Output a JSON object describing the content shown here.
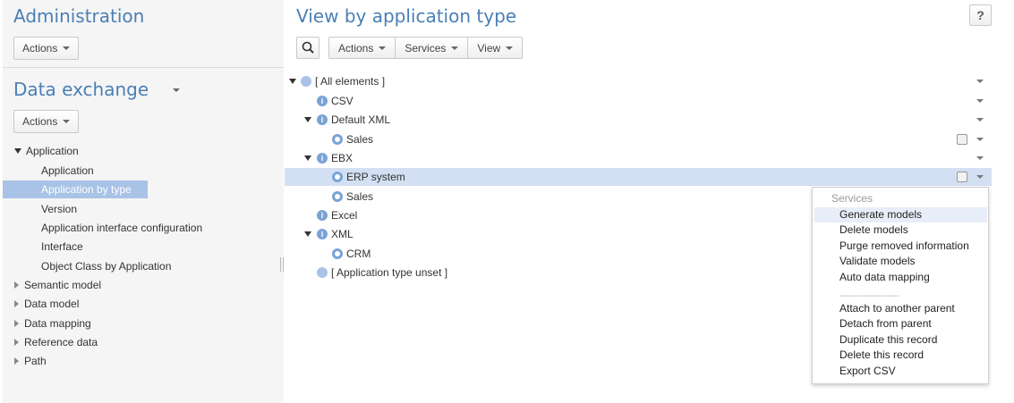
{
  "sidebar": {
    "admin_title": "Administration",
    "admin_actions": "Actions",
    "section_title": "Data exchange",
    "section_actions": "Actions",
    "tree": [
      {
        "label": "Application",
        "level": "top",
        "expanded": true
      },
      {
        "label": "Application",
        "level": "sub"
      },
      {
        "label": "Application by type",
        "level": "sub",
        "selected": true
      },
      {
        "label": "Version",
        "level": "sub"
      },
      {
        "label": "Application interface configuration",
        "level": "sub"
      },
      {
        "label": "Interface",
        "level": "sub"
      },
      {
        "label": "Object Class by Application",
        "level": "sub"
      },
      {
        "label": "Semantic model",
        "level": "top",
        "expanded": false
      },
      {
        "label": "Data model",
        "level": "top",
        "expanded": false
      },
      {
        "label": "Data mapping",
        "level": "top",
        "expanded": false
      },
      {
        "label": "Reference data",
        "level": "top",
        "expanded": false
      },
      {
        "label": "Path",
        "level": "top",
        "expanded": false
      }
    ]
  },
  "main": {
    "title": "View by application type",
    "help_label": "?",
    "toolbar": {
      "actions": "Actions",
      "services": "Services",
      "view": "View"
    },
    "tree": [
      {
        "label": "[ All elements ]",
        "icon": "plain"
      },
      {
        "label": "CSV",
        "icon": "info"
      },
      {
        "label": "Default XML",
        "icon": "info"
      },
      {
        "label": "Sales",
        "icon": "ring"
      },
      {
        "label": "EBX",
        "icon": "info"
      },
      {
        "label": "ERP system",
        "icon": "ring"
      },
      {
        "label": "Sales",
        "icon": "ring"
      },
      {
        "label": "Excel",
        "icon": "info"
      },
      {
        "label": "XML",
        "icon": "info"
      },
      {
        "label": "CRM",
        "icon": "ring"
      },
      {
        "label": "[ Application type unset ]",
        "icon": "plain"
      }
    ]
  },
  "menu": {
    "header": "Services",
    "items": [
      "Generate models",
      "Delete models",
      "Purge removed information",
      "Validate models",
      "Auto data mapping",
      "Attach to another parent",
      "Detach from parent",
      "Duplicate this record",
      "Delete this record",
      "Export CSV"
    ],
    "divider": "--------------------"
  },
  "colors": {
    "accent": "#4a7fb5",
    "selection": "#a9c3e6",
    "row_selection": "#d3e0f3"
  }
}
